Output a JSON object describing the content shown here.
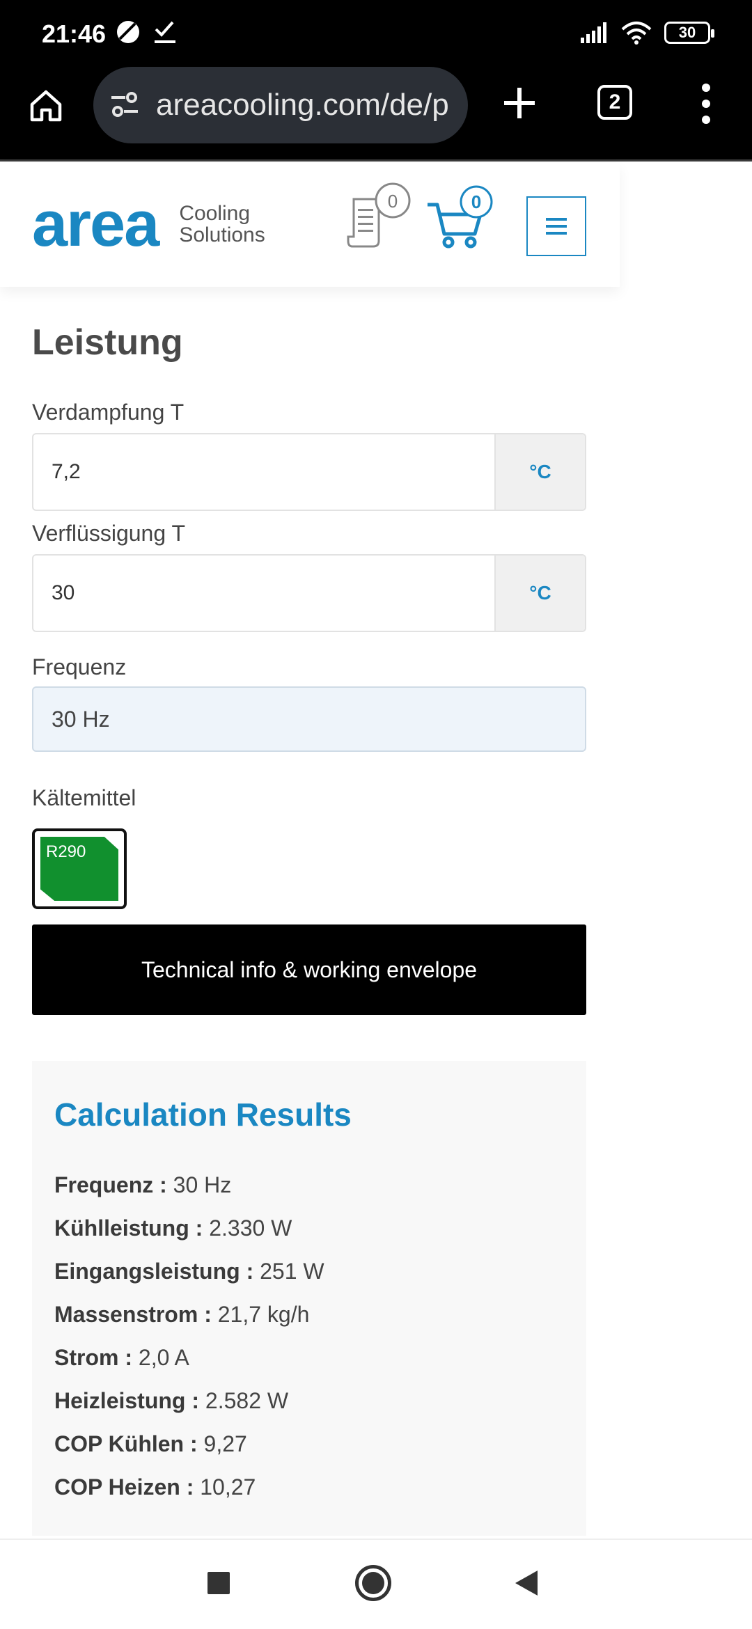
{
  "status": {
    "time": "21:46",
    "battery": "30"
  },
  "browser": {
    "url": "areacooling.com/de/p",
    "tab_count": "2"
  },
  "header": {
    "logo_word": "area",
    "logo_sub_1": "Cooling",
    "logo_sub_2": "Solutions",
    "quote_count": "0",
    "cart_count": "0"
  },
  "form": {
    "section_title": "Leistung",
    "evaporation": {
      "label": "Verdampfung T",
      "value": "7,2",
      "unit": "°C"
    },
    "condensation": {
      "label": "Verflüssigung T",
      "value": "30",
      "unit": "°C"
    },
    "frequency": {
      "label": "Frequenz",
      "value": "30 Hz"
    },
    "refrigerant": {
      "label": "Kältemittel",
      "value": "R290",
      "color": "#11902e"
    },
    "tech_button": "Technical info & working envelope"
  },
  "results": {
    "title": "Calculation Results",
    "rows": [
      {
        "label": "Frequenz :",
        "value": "30 Hz"
      },
      {
        "label": "Kühlleistung :",
        "value": "2.330 W"
      },
      {
        "label": "Eingangsleistung :",
        "value": "251 W"
      },
      {
        "label": "Massenstrom :",
        "value": "21,7 kg/h"
      },
      {
        "label": "Strom :",
        "value": "2,0 A"
      },
      {
        "label": "Heizleistung :",
        "value": "2.582 W"
      },
      {
        "label": "COP Kühlen :",
        "value": "9,27"
      },
      {
        "label": "COP Heizen :",
        "value": "10,27"
      }
    ]
  },
  "colors": {
    "brand_blue": "#1a87c2",
    "button_black": "#000000"
  }
}
